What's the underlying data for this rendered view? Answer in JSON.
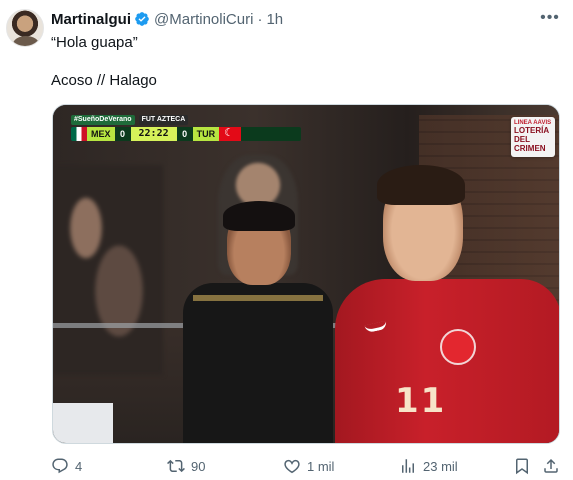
{
  "tweet": {
    "author_name": "Martinalgui",
    "handle": "@MartinoliCuri",
    "separator": "·",
    "time": "1h",
    "verified": true,
    "more_icon": "more-horizontal-icon",
    "text_line1": "“Hola guapa”",
    "text_line2": "Acoso // Halago"
  },
  "media": {
    "scorebug": {
      "tag_left": "#SueñoDeVerano",
      "tag_right": "FUT AZTECA",
      "team_home": "MEX",
      "score_home": "0",
      "clock": "22:22",
      "score_away": "0",
      "team_away": "TUR"
    },
    "corner_bug": {
      "top": "LINEA AAVIS",
      "main1": "LOTERÍA",
      "main2": "DEL CRIMEN"
    },
    "jersey_number": "11"
  },
  "actions": {
    "replies": "4",
    "retweets": "90",
    "likes": "1 mil",
    "views": "23 mil"
  },
  "colors": {
    "text_primary": "#0f1419",
    "text_secondary": "#536471",
    "verified_blue": "#1d9bf0",
    "border": "#cfd9de"
  }
}
